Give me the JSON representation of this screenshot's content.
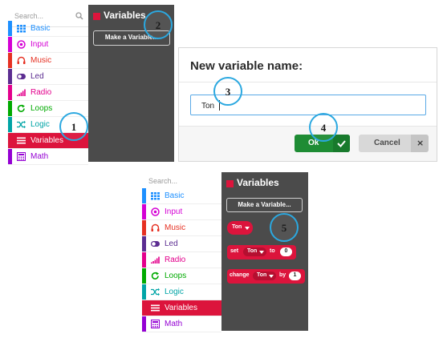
{
  "colors": {
    "basic": "#1e90ff",
    "input": "#d400d4",
    "music": "#e63022",
    "led": "#5c2d91",
    "radio": "#e3008c",
    "loops": "#00aa00",
    "logic": "#00a4a6",
    "variables": "#dc143c",
    "math": "#9400d3",
    "flyout_bg": "#4b4b4b",
    "ok_green": "#1e8c34",
    "callout_ring": "#2ba8e0"
  },
  "toolbox_top": {
    "search_placeholder": "Search...",
    "items": [
      {
        "label": "Basic",
        "icon": "grid-icon"
      },
      {
        "label": "Input",
        "icon": "target-icon"
      },
      {
        "label": "Music",
        "icon": "headphones-icon"
      },
      {
        "label": "Led",
        "icon": "toggle-icon"
      },
      {
        "label": "Radio",
        "icon": "signal-bars-icon"
      },
      {
        "label": "Loops",
        "icon": "refresh-icon"
      },
      {
        "label": "Logic",
        "icon": "shuffle-icon"
      },
      {
        "label": "Variables",
        "icon": "list-icon"
      },
      {
        "label": "Math",
        "icon": "calculator-icon"
      }
    ]
  },
  "flyout_top": {
    "title": "Variables",
    "make_variable_label": "Make a Variable..."
  },
  "dialog": {
    "title": "New variable name:",
    "input_value": "Ton",
    "ok_label": "Ok",
    "cancel_label": "Cancel",
    "cancel_icon": "×"
  },
  "toolbox_bottom": {
    "search_placeholder": "Search...",
    "items": [
      {
        "label": "Basic",
        "icon": "grid-icon"
      },
      {
        "label": "Input",
        "icon": "target-icon"
      },
      {
        "label": "Music",
        "icon": "headphones-icon"
      },
      {
        "label": "Led",
        "icon": "toggle-icon"
      },
      {
        "label": "Radio",
        "icon": "signal-bars-icon"
      },
      {
        "label": "Loops",
        "icon": "refresh-icon"
      },
      {
        "label": "Logic",
        "icon": "shuffle-icon"
      },
      {
        "label": "Variables",
        "icon": "list-icon"
      },
      {
        "label": "Math",
        "icon": "calculator-icon"
      }
    ]
  },
  "flyout_bottom": {
    "title": "Variables",
    "make_variable_label": "Make a Variable...",
    "blocks": {
      "var_name": "Ton",
      "set_keyword": "set",
      "set_to": "to",
      "set_value": "0",
      "change_keyword": "change",
      "change_by": "by",
      "change_value": "1"
    }
  },
  "callouts": [
    "1",
    "2",
    "3",
    "4",
    "5"
  ]
}
